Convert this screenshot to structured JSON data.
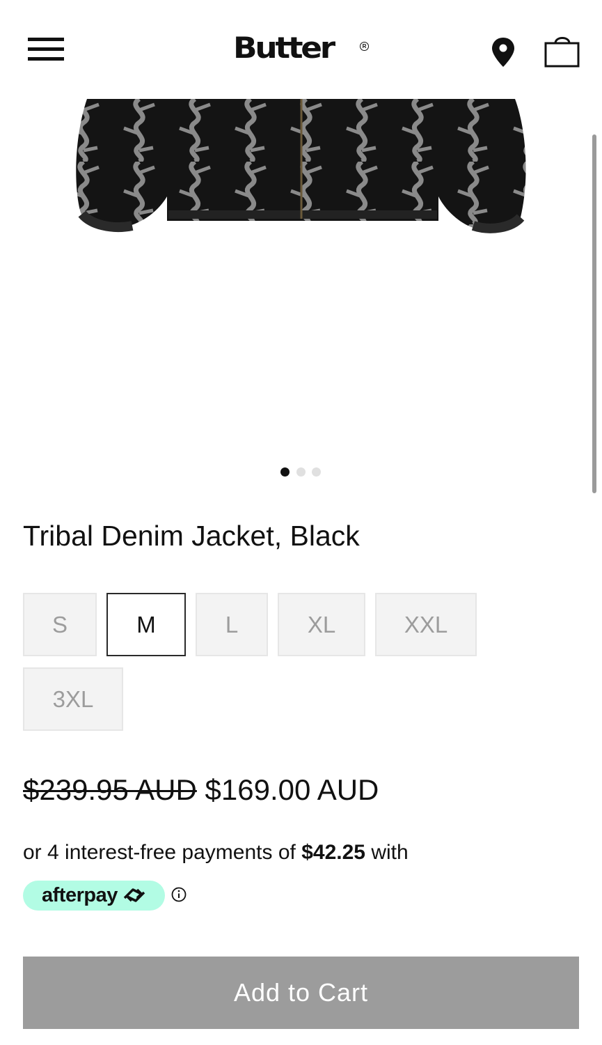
{
  "header": {
    "brand": "Butter",
    "registered_mark": "R",
    "icons": [
      "menu-icon",
      "location-pin-icon",
      "shopping-bag-icon"
    ]
  },
  "gallery": {
    "slide_count": 3,
    "active_slide": 1
  },
  "product": {
    "title": "Tribal Denim Jacket, Black",
    "sizes": [
      "S",
      "M",
      "L",
      "XL",
      "XXL",
      "3XL"
    ],
    "selected_size": "M",
    "original_price": "$239.95 AUD",
    "sale_price": "$169.00 AUD"
  },
  "payment": {
    "installments_prefix": "or 4 interest-free payments of",
    "installment_amount": "$42.25",
    "installments_suffix": "with",
    "provider": "afterpay",
    "provider_color": "#b2fce4"
  },
  "cart": {
    "button_label": "Add to Cart",
    "button_color": "#9c9c9c"
  }
}
